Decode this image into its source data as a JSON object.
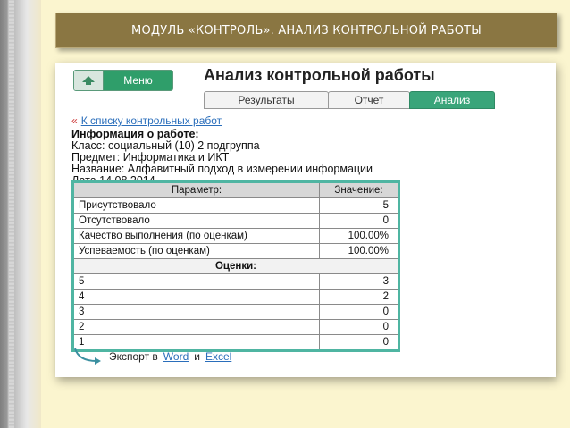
{
  "slide": {
    "title": "МОДУЛЬ «КОНТРОЛЬ». АНАЛИЗ КОНТРОЛЬНОЙ РАБОТЫ"
  },
  "app": {
    "menu_label": "Меню",
    "page_heading": "Анализ контрольной работы",
    "tabs": [
      {
        "label": "Результаты",
        "active": false
      },
      {
        "label": "Отчет",
        "active": false
      },
      {
        "label": "Анализ",
        "active": true
      }
    ],
    "back_arrow": "«",
    "back_link": "К списку контрольных работ",
    "info": {
      "heading": "Информация о работе:",
      "class_line": "Класс: социальный (10) 2 подгруппа",
      "subject_line": "Предмет: Информатика и ИКТ",
      "name_line": "Название: Алфавитный подход в измерении информации",
      "date_line": "Дата 14.08.2014"
    },
    "table": {
      "headers": [
        "Параметр:",
        "Значение:"
      ],
      "rows": [
        {
          "param": "Присутствовало",
          "value": "5"
        },
        {
          "param": "Отсутствовало",
          "value": "0"
        },
        {
          "param": "Качество выполнения (по оценкам)",
          "value": "100.00%"
        },
        {
          "param": "Успеваемость (по оценкам)",
          "value": "100.00%"
        }
      ],
      "grades_heading": "Оценки:",
      "grades": [
        {
          "grade": "5",
          "count": "3"
        },
        {
          "grade": "4",
          "count": "2"
        },
        {
          "grade": "3",
          "count": "0"
        },
        {
          "grade": "2",
          "count": "0"
        },
        {
          "grade": "1",
          "count": "0"
        }
      ]
    },
    "export": {
      "prefix": "Экспорт в",
      "word": "Word",
      "and": "и",
      "excel": "Excel"
    }
  },
  "colors": {
    "banner": "#8a7642",
    "accent": "#2f9e6a",
    "table_border": "#4fb5a2",
    "background": "#fbf5cf"
  }
}
